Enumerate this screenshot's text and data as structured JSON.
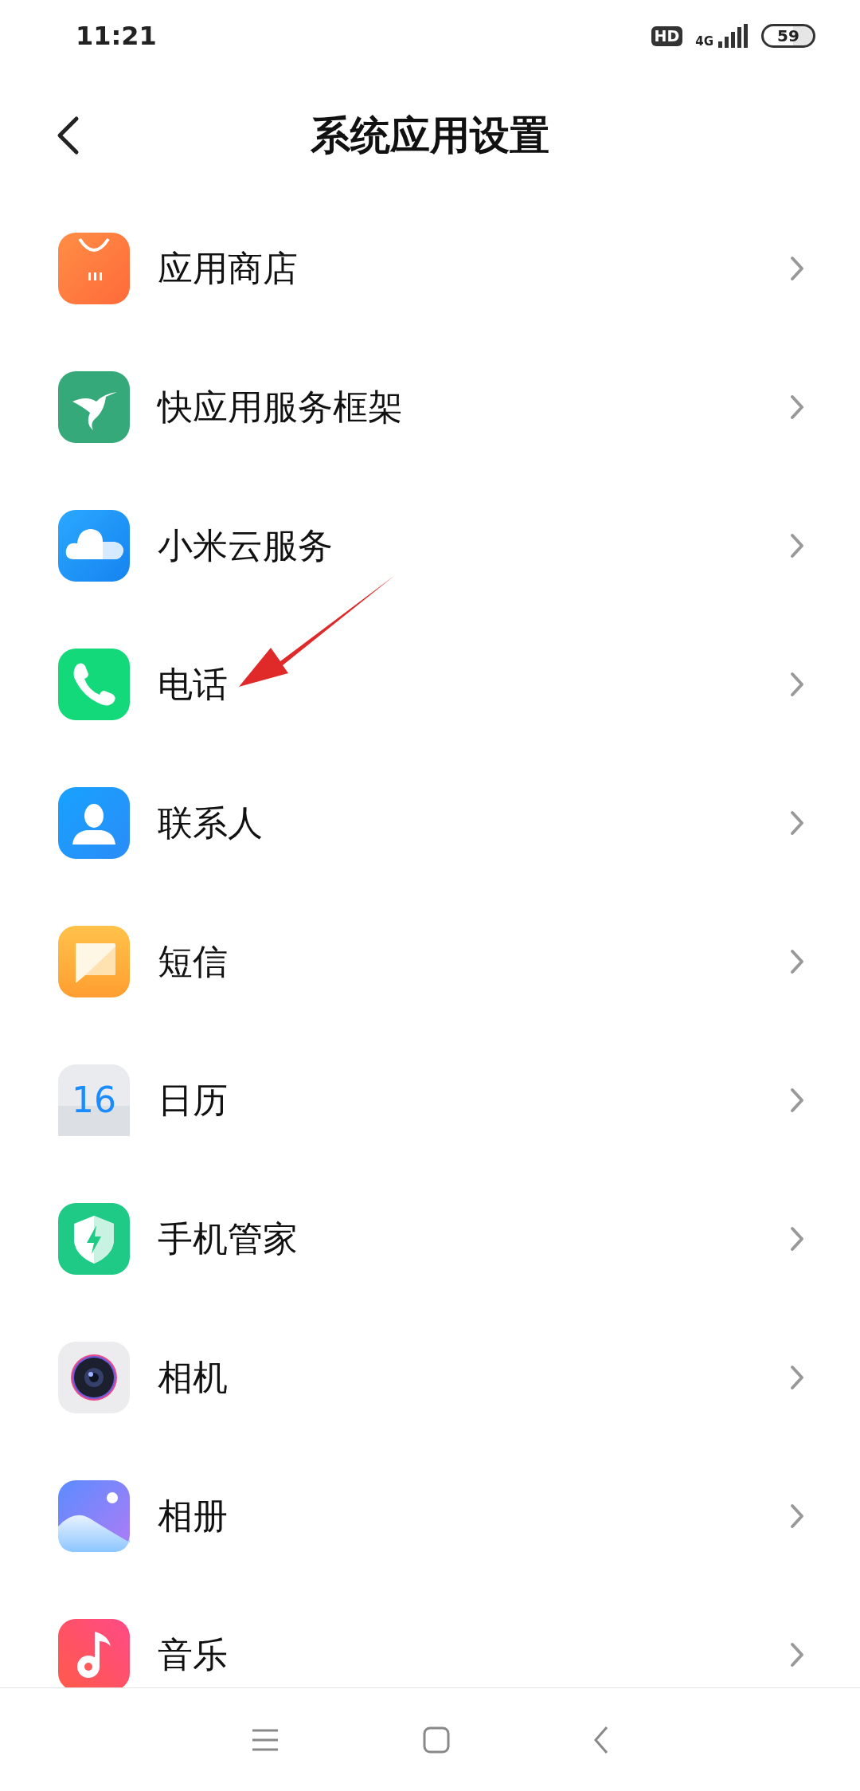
{
  "status_bar": {
    "time": "11:21",
    "hd": "HD",
    "network": "4G",
    "battery": "59"
  },
  "header": {
    "title": "系统应用设置"
  },
  "items": [
    {
      "label": "应用商店"
    },
    {
      "label": "快应用服务框架"
    },
    {
      "label": "小米云服务"
    },
    {
      "label": "电话"
    },
    {
      "label": "联系人"
    },
    {
      "label": "短信"
    },
    {
      "label": "日历",
      "icon_text": "16"
    },
    {
      "label": "手机管家"
    },
    {
      "label": "相机"
    },
    {
      "label": "相册"
    },
    {
      "label": "音乐"
    }
  ]
}
